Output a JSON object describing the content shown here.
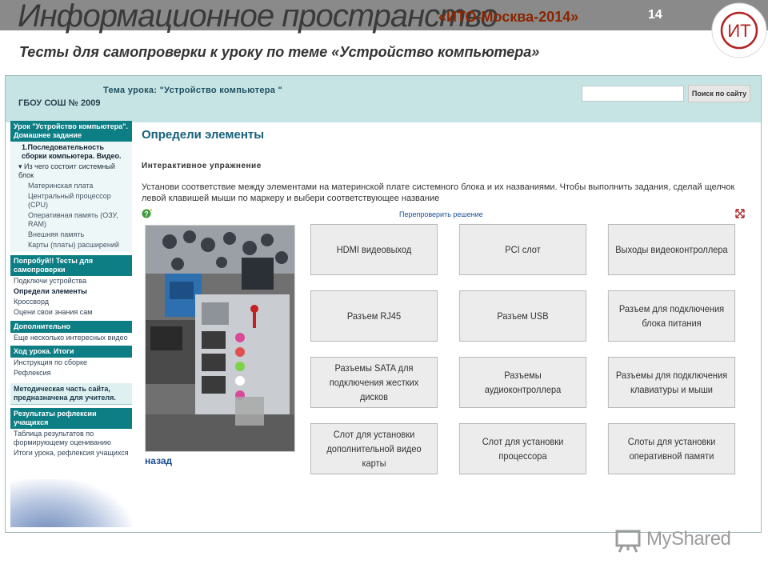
{
  "slide": {
    "title": "Информационное пространство",
    "conference": "«ИТО-Москва-2014»",
    "number": "14",
    "subtitle": "Тесты для самопроверки  к уроку по теме «Устройство компьютера»",
    "logo_text": "ИТ"
  },
  "site": {
    "lesson_title": "Тема урока: \"Устройство компьютера \"",
    "school": "ГБОУ СОШ № 2009",
    "search_placeholder": "",
    "search_button": "Поиск по сайту"
  },
  "sidebar": {
    "section1_title": "Урок \"Устройство компьютера\". Домашнее задание",
    "section1_items": [
      "1.Последовательность сборки компьютера. Видео.",
      "Из чего состоит системный блок"
    ],
    "section1_subitems": [
      "Материнская плата",
      "Центральный процессор (CPU)",
      "Оперативная память (ОЗУ, RAM)",
      "Внешняя память",
      "Карты (платы) расширений"
    ],
    "section2_title": "Попробуй!! Тесты для самопроверки",
    "section2_items": [
      "Подключи устройства",
      "Определи элементы",
      "Кроссворд",
      "Оцени свои знания сам"
    ],
    "section3_title": "Дополнительно",
    "section3_items": [
      "Еще несколько интересных видео"
    ],
    "section4_title": "Ход урока. Итоги",
    "section4_items": [
      "Инструкция по сборке",
      "Рефлексия"
    ],
    "section5_title": "Методическая часть сайта, предназначена для учителя.",
    "section6_title": "Результаты рефлексии учащихся",
    "section6_items": [
      "Таблица результатов по формирующему оцениванию",
      "Итоги урока, рефлексия учащихся"
    ]
  },
  "exercise": {
    "title": "Определи элементы",
    "subtitle": "Интерактивное упражнение",
    "instruction": "Установи соответствие между элементами на материнской плате системного блока и их названиями. Чтобы выполнить задания, сделай щелчок левой клавишей мыши по маркеру и выбери соответствующее название",
    "recheck": "Перепроверить решение",
    "back": "назад",
    "answers": [
      [
        "HDMI видеовыход"
      ],
      [
        "PCI слот"
      ],
      [
        "Выходы видеоконтроллера"
      ],
      [
        "Разъем RJ45"
      ],
      [
        "Разъем USB"
      ],
      [
        "Разъем для подключения",
        "блока питания"
      ],
      [
        "Разъемы SATA для",
        "подключения жестких дисков"
      ],
      [
        "Разъемы аудиоконтроллера"
      ],
      [
        "Разъемы для подключения",
        "клавиатуры и мыши"
      ],
      [
        "Слот для установки",
        "дополнительной видео карты"
      ],
      [
        "Слот для установки",
        "процессора"
      ],
      [
        "Слоты для установки",
        "оперативной памяти"
      ]
    ]
  },
  "footer": {
    "watermark": "MyShared"
  }
}
